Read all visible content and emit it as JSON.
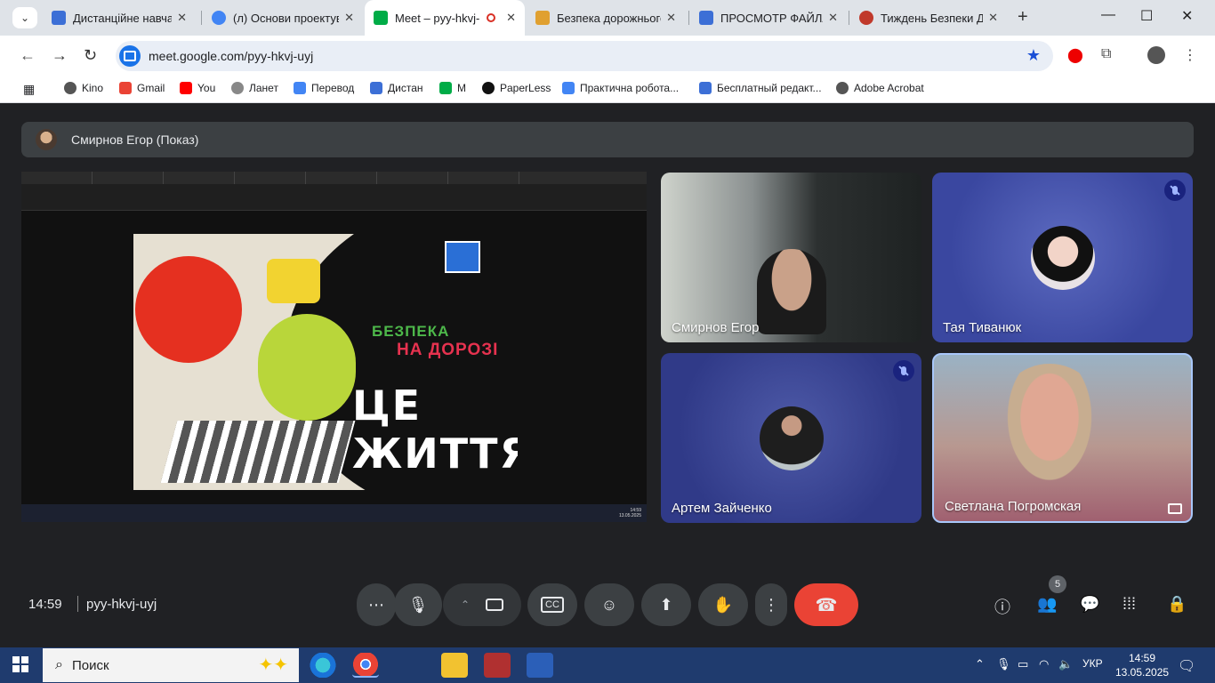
{
  "browser": {
    "tabs": [
      {
        "title": "Дистанційне навчан",
        "favicon_color": "#3c6fd6",
        "active": false
      },
      {
        "title": "(л) Основи проектув",
        "favicon_color": "#4285f4",
        "active": false
      },
      {
        "title": "Meet – pyy-hkvj-",
        "favicon_color": "#00ac47",
        "active": true
      },
      {
        "title": "Безпека дорожнього",
        "favicon_color": "#e0a030",
        "active": false
      },
      {
        "title": "ПРОСМОТР ФАЙЛА",
        "favicon_color": "#3c6fd6",
        "active": false
      },
      {
        "title": "Тиждень Безпеки Д",
        "favicon_color": "#c0392b",
        "active": false
      }
    ],
    "url": "meet.google.com/pyy-hkvj-uyj",
    "bookmarks": [
      {
        "label": "Kino",
        "color": "#555"
      },
      {
        "label": "Gmail",
        "color": "#ea4335"
      },
      {
        "label": "You",
        "color": "#ff0000"
      },
      {
        "label": "Ланет",
        "color": "#666"
      },
      {
        "label": "Перевод",
        "color": "#4285f4"
      },
      {
        "label": "Дистан",
        "color": "#3c6fd6"
      },
      {
        "label": "M",
        "color": "#00ac47"
      },
      {
        "label": "PaperLess",
        "color": "#111"
      },
      {
        "label": "Практична робота...",
        "color": "#4285f4"
      },
      {
        "label": "Бесплатный редакт...",
        "color": "#3c6fd6"
      },
      {
        "label": "Adobe Acrobat",
        "color": "#555"
      }
    ]
  },
  "meet": {
    "presenter_label": "Смирнов Егор (Показ)",
    "shared_screen": {
      "poster_line1": "БЕЗПЕКА",
      "poster_line2": "НА ДОРОЗІ",
      "poster_line3": "ЦЕ ЖИТТЯ",
      "time": "14:59",
      "date": "13.05.2025"
    },
    "participants": [
      {
        "name": "Смирнов Егор",
        "muted": false,
        "video": true
      },
      {
        "name": "Тая Тиванюк",
        "muted": true,
        "video": false
      },
      {
        "name": "Артем Зайченко",
        "muted": true,
        "video": false
      },
      {
        "name": "Светлана Погромская",
        "muted": false,
        "video": true
      }
    ],
    "clock": "14:59",
    "meeting_code": "pyy-hkvj-uyj",
    "people_count": "5"
  },
  "taskbar": {
    "search_placeholder": "Поиск",
    "language": "УКР",
    "time": "14:59",
    "date": "13.05.2025"
  }
}
